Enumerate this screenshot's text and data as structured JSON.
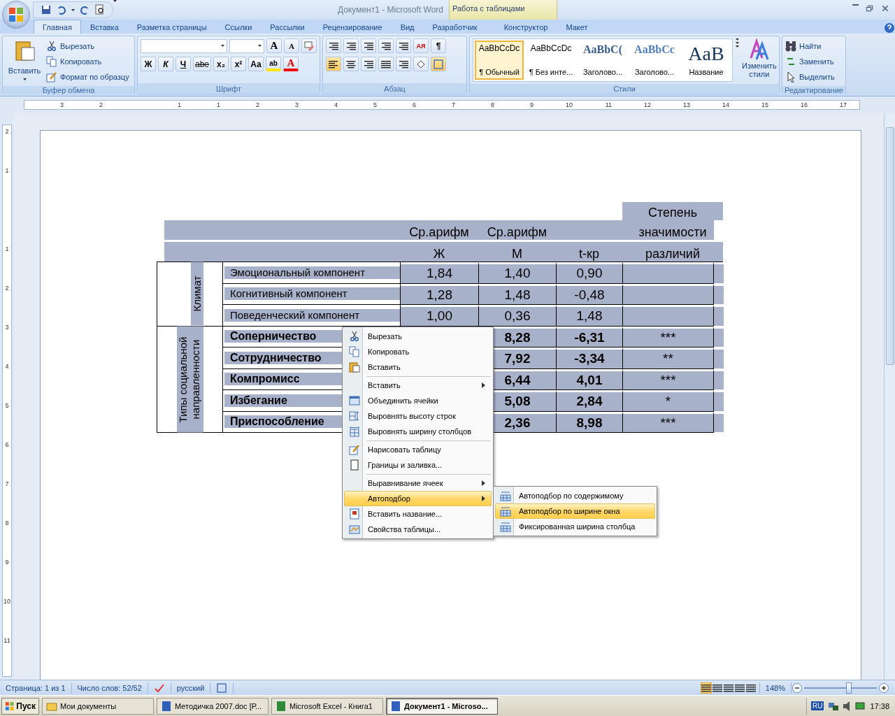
{
  "window": {
    "title": "Документ1 - Microsoft Word",
    "contextual_group": "Работа с таблицами"
  },
  "tabs": [
    {
      "label": "Главная",
      "selected": true,
      "kind": "main"
    },
    {
      "label": "Вставка",
      "selected": false,
      "kind": "main"
    },
    {
      "label": "Разметка страницы",
      "selected": false,
      "kind": "main"
    },
    {
      "label": "Ссылки",
      "selected": false,
      "kind": "main"
    },
    {
      "label": "Рассылки",
      "selected": false,
      "kind": "main"
    },
    {
      "label": "Рецензирование",
      "selected": false,
      "kind": "main"
    },
    {
      "label": "Вид",
      "selected": false,
      "kind": "main"
    },
    {
      "label": "Разработчик",
      "selected": false,
      "kind": "main"
    },
    {
      "label": "Конструктор",
      "selected": false,
      "kind": "contextual"
    },
    {
      "label": "Макет",
      "selected": false,
      "kind": "contextual"
    }
  ],
  "clipboard": {
    "label": "Буфер обмена",
    "paste": "Вставить",
    "buttons": [
      "Вырезать",
      "Копировать",
      "Формат по образцу"
    ]
  },
  "font": {
    "label": "Шрифт",
    "size_buttons": [
      "A",
      "A"
    ],
    "format_buttons": [
      "Ж",
      "К",
      "Ч",
      "abe",
      "x₂",
      "x²",
      "Aa"
    ],
    "highlight": "ab",
    "font_color": "A"
  },
  "paragraph": {
    "label": "Абзац",
    "pilcrow": "¶",
    "sort": "АЯ",
    "align": [
      {
        "selected": true
      },
      {
        "selected": false
      },
      {
        "selected": false
      },
      {
        "selected": false
      }
    ],
    "borders_selected": true
  },
  "styles": {
    "label": "Стили",
    "change": "Изменить стили",
    "items": [
      {
        "preview": "AaBbCcDc",
        "name": "¶ Обычный",
        "kind": "normal",
        "selected": true
      },
      {
        "preview": "AaBbCcDc",
        "name": "¶ Без инте...",
        "kind": "normal",
        "selected": false
      },
      {
        "preview": "AaBbC(",
        "name": "Заголово...",
        "kind": "heading1",
        "selected": false
      },
      {
        "preview": "AaBbCc",
        "name": "Заголово...",
        "kind": "heading2",
        "selected": false
      },
      {
        "preview": "AaB",
        "name": "Название",
        "kind": "title",
        "selected": false
      }
    ]
  },
  "editing": {
    "label": "Редактирование",
    "buttons": [
      "Найти",
      "Заменить",
      "Выделить"
    ]
  },
  "ruler": {
    "horizontal": [
      "3",
      "2",
      "1",
      "1",
      "2",
      "3",
      "4",
      "5",
      "6",
      "7",
      "8",
      "9",
      "10",
      "11",
      "12",
      "13",
      "14",
      "15",
      "16",
      "17"
    ],
    "vertical": [
      "2",
      "1",
      "1",
      "2",
      "3",
      "4",
      "5",
      "6",
      "7",
      "8",
      "9",
      "10",
      "11"
    ]
  },
  "table": {
    "header": {
      "significance_1": "Степень",
      "significance_2": "значимости",
      "significance_3": "различий",
      "mean_1": "Ср.арифм",
      "mean_2": "Ср.арифм",
      "col_f": "Ж",
      "col_m": "М",
      "col_t": "t-кр"
    },
    "groups": [
      {
        "label": "Климат",
        "rows": [
          {
            "label": "Эмоциональный компонент",
            "bold": false,
            "f": "1,84",
            "m": "1,40",
            "t": "0,90",
            "sig": ""
          },
          {
            "label": "Когнитивный компонент",
            "bold": false,
            "f": "1,28",
            "m": "1,48",
            "t": "-0,48",
            "sig": ""
          },
          {
            "label": "Поведенческий компонент",
            "bold": false,
            "f": "1,00",
            "m": "0,36",
            "t": "1,48",
            "sig": ""
          }
        ]
      },
      {
        "label": "Типы социальной направленности",
        "rows": [
          {
            "label": "Соперничество",
            "bold": true,
            "m": "8,28",
            "t": "-6,31",
            "sig": "***"
          },
          {
            "label": "Сотрудничество",
            "bold": true,
            "m": "7,92",
            "t": "-3,34",
            "sig": "**"
          },
          {
            "label": "Компромисс",
            "bold": true,
            "m": "6,44",
            "t": "4,01",
            "sig": "***"
          },
          {
            "label": "Избегание",
            "bold": true,
            "m": "5,08",
            "t": "2,84",
            "sig": "*"
          },
          {
            "label": "Приспособление",
            "bold": true,
            "m": "2,36",
            "t": "8,98",
            "sig": "***"
          }
        ]
      }
    ]
  },
  "context_menu": [
    {
      "label": "Вырезать",
      "kind": "item",
      "separator_before": false,
      "selected": false
    },
    {
      "label": "Копировать",
      "kind": "item",
      "separator_before": false,
      "selected": false
    },
    {
      "label": "Вставить",
      "kind": "item",
      "separator_before": false,
      "selected": false
    },
    {
      "label": "Вставить",
      "kind": "submenu",
      "separator_before": true,
      "selected": false
    },
    {
      "label": "Объединить ячейки",
      "kind": "item",
      "separator_before": false,
      "selected": false
    },
    {
      "label": "Выровнять высоту строк",
      "kind": "item",
      "separator_before": false,
      "selected": false
    },
    {
      "label": "Выровнять ширину столбцов",
      "kind": "item",
      "separator_before": false,
      "selected": false
    },
    {
      "label": "Нарисовать таблицу",
      "kind": "item",
      "separator_before": true,
      "selected": false
    },
    {
      "label": "Границы и заливка...",
      "kind": "item",
      "separator_before": false,
      "selected": false
    },
    {
      "label": "Выравнивание ячеек",
      "kind": "submenu",
      "separator_before": true,
      "selected": false
    },
    {
      "label": "Автоподбор",
      "kind": "submenu",
      "separator_before": false,
      "selected": true
    },
    {
      "label": "Вставить название...",
      "kind": "item",
      "separator_before": false,
      "selected": false
    },
    {
      "label": "Свойства таблицы...",
      "kind": "item",
      "separator_before": false,
      "selected": false
    }
  ],
  "submenu": [
    {
      "label": "Автоподбор по содержимому",
      "selected": false
    },
    {
      "label": "Автоподбор по ширине окна",
      "selected": true
    },
    {
      "label": "Фиксированная ширина столбца",
      "selected": false
    }
  ],
  "status_bar": {
    "page": "Страница: 1 из 1",
    "words": "Число слов: 52/52",
    "language": "русский",
    "views": [
      {
        "selected": true
      },
      {
        "selected": false
      },
      {
        "selected": false
      },
      {
        "selected": false
      },
      {
        "selected": false
      }
    ],
    "zoom": "148%",
    "level": 0.62
  },
  "taskbar": {
    "start": "Пуск",
    "tasks": [
      {
        "label": "Мои документы",
        "selected": false
      },
      {
        "label": "Методичка 2007.doc [Р...",
        "selected": false
      },
      {
        "label": "Microsoft Excel - Книга1",
        "selected": false
      },
      {
        "label": "Документ1 - Microso...",
        "selected": true
      }
    ],
    "language": "RU",
    "time": "17:38"
  }
}
